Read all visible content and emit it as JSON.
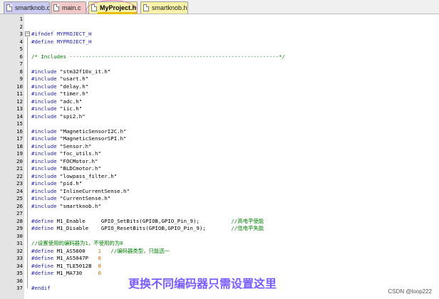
{
  "tabs": [
    {
      "label": "smartknob.c",
      "color": "#c9c9f2",
      "active": false
    },
    {
      "label": "main.c",
      "color": "#f2c9c9",
      "active": false
    },
    {
      "label": "MyProject.h",
      "color": "#f7f2a8",
      "active": true
    },
    {
      "label": "smartknob.h",
      "color": "#f7f2a8",
      "active": false
    }
  ],
  "editor": {
    "lines": [
      {
        "n": "1",
        "segs": []
      },
      {
        "n": "2",
        "segs": []
      },
      {
        "n": "3",
        "fold": "−",
        "segs": [
          {
            "t": "#ifndef MYPROJECT_H",
            "c": "kw"
          }
        ]
      },
      {
        "n": "4",
        "segs": [
          {
            "t": "#define MYPROJECT_H",
            "c": "kw"
          }
        ]
      },
      {
        "n": "5",
        "segs": []
      },
      {
        "n": "6",
        "segs": [
          {
            "t": "/* Includes ------------------------------------------------------------------*/",
            "c": "cmt"
          }
        ]
      },
      {
        "n": "7",
        "segs": []
      },
      {
        "n": "8",
        "segs": [
          {
            "t": "#include ",
            "c": "kw"
          },
          {
            "t": "\"stm32f10x_it.h\"",
            "c": "str"
          }
        ]
      },
      {
        "n": "9",
        "segs": [
          {
            "t": "#include ",
            "c": "kw"
          },
          {
            "t": "\"usart.h\"",
            "c": "str"
          }
        ]
      },
      {
        "n": "10",
        "segs": [
          {
            "t": "#include ",
            "c": "kw"
          },
          {
            "t": "\"delay.h\"",
            "c": "str"
          }
        ]
      },
      {
        "n": "11",
        "segs": [
          {
            "t": "#include ",
            "c": "kw"
          },
          {
            "t": "\"timer.h\"",
            "c": "str"
          }
        ]
      },
      {
        "n": "12",
        "segs": [
          {
            "t": "#include ",
            "c": "kw"
          },
          {
            "t": "\"adc.h\"",
            "c": "str"
          }
        ]
      },
      {
        "n": "13",
        "segs": [
          {
            "t": "#include ",
            "c": "kw"
          },
          {
            "t": "\"iic.h\"",
            "c": "str"
          }
        ]
      },
      {
        "n": "14",
        "segs": [
          {
            "t": "#include ",
            "c": "kw"
          },
          {
            "t": "\"spi2.h\"",
            "c": "str"
          }
        ]
      },
      {
        "n": "15",
        "segs": []
      },
      {
        "n": "16",
        "segs": [
          {
            "t": "#include ",
            "c": "kw"
          },
          {
            "t": "\"MagneticSensorI2C.h\"",
            "c": "str"
          }
        ]
      },
      {
        "n": "17",
        "segs": [
          {
            "t": "#include ",
            "c": "kw"
          },
          {
            "t": "\"MagneticSensorSPI.h\"",
            "c": "str"
          }
        ]
      },
      {
        "n": "18",
        "segs": [
          {
            "t": "#include ",
            "c": "kw"
          },
          {
            "t": "\"Sensor.h\"",
            "c": "str"
          }
        ]
      },
      {
        "n": "19",
        "segs": [
          {
            "t": "#include ",
            "c": "kw"
          },
          {
            "t": "\"foc_utils.h\"",
            "c": "str"
          }
        ]
      },
      {
        "n": "20",
        "segs": [
          {
            "t": "#include ",
            "c": "kw"
          },
          {
            "t": "\"FOCMotor.h\"",
            "c": "str"
          }
        ]
      },
      {
        "n": "21",
        "segs": [
          {
            "t": "#include ",
            "c": "kw"
          },
          {
            "t": "\"BLDCmotor.h\"",
            "c": "str"
          }
        ]
      },
      {
        "n": "22",
        "segs": [
          {
            "t": "#include ",
            "c": "kw"
          },
          {
            "t": "\"lowpass_filter.h\"",
            "c": "str"
          }
        ]
      },
      {
        "n": "23",
        "segs": [
          {
            "t": "#include ",
            "c": "kw"
          },
          {
            "t": "\"pid.h\"",
            "c": "str"
          }
        ]
      },
      {
        "n": "24",
        "segs": [
          {
            "t": "#include ",
            "c": "kw"
          },
          {
            "t": "\"InlineCurrentSense.h\"",
            "c": "str"
          }
        ]
      },
      {
        "n": "25",
        "segs": [
          {
            "t": "#include ",
            "c": "kw"
          },
          {
            "t": "\"CurrentSense.h\"",
            "c": "str"
          }
        ]
      },
      {
        "n": "26",
        "segs": [
          {
            "t": "#include ",
            "c": "kw"
          },
          {
            "t": "\"smartknob.h\"",
            "c": "str"
          }
        ]
      },
      {
        "n": "27",
        "segs": []
      },
      {
        "n": "28",
        "segs": [
          {
            "t": "#define ",
            "c": "kw"
          },
          {
            "t": "M1_Enable     GPIO_SetBits(GPIOB,GPIO_Pin_9);          ",
            "c": "str"
          },
          {
            "t": "//高电平使能",
            "c": "cmt"
          }
        ]
      },
      {
        "n": "29",
        "segs": [
          {
            "t": "#define ",
            "c": "kw"
          },
          {
            "t": "M1_Disable    GPIO_ResetBits(GPIOB,GPIO_Pin_9);        ",
            "c": "str"
          },
          {
            "t": "//低电平失能",
            "c": "cmt"
          }
        ]
      },
      {
        "n": "30",
        "segs": []
      },
      {
        "n": "31",
        "segs": [
          {
            "t": "//设置使用的编码器为1，不使用的为0",
            "c": "cmt"
          }
        ]
      },
      {
        "n": "32",
        "segs": [
          {
            "t": "#define ",
            "c": "kw"
          },
          {
            "t": "M1_AS5600    ",
            "c": "str"
          },
          {
            "t": "1",
            "c": "num"
          },
          {
            "t": "   ",
            "c": "str"
          },
          {
            "t": "//编码器类型，只能选一",
            "c": "cmt"
          }
        ]
      },
      {
        "n": "33",
        "segs": [
          {
            "t": "#define ",
            "c": "kw"
          },
          {
            "t": "M1_AS5047P   ",
            "c": "str"
          },
          {
            "t": "0",
            "c": "num"
          }
        ]
      },
      {
        "n": "34",
        "segs": [
          {
            "t": "#define ",
            "c": "kw"
          },
          {
            "t": "M1_TLE5012B  ",
            "c": "str"
          },
          {
            "t": "0",
            "c": "num"
          }
        ]
      },
      {
        "n": "35",
        "segs": [
          {
            "t": "#define ",
            "c": "kw"
          },
          {
            "t": "M1_MA730     ",
            "c": "str"
          },
          {
            "t": "0",
            "c": "num"
          }
        ]
      },
      {
        "n": "36",
        "segs": []
      },
      {
        "n": "37",
        "segs": [
          {
            "t": "#endif",
            "c": "kw"
          }
        ]
      }
    ]
  },
  "annotation": {
    "text": "更换不同编码器只需设置这里",
    "color": "#7b5cff"
  },
  "watermark": {
    "text": "CSDN @loop222"
  }
}
